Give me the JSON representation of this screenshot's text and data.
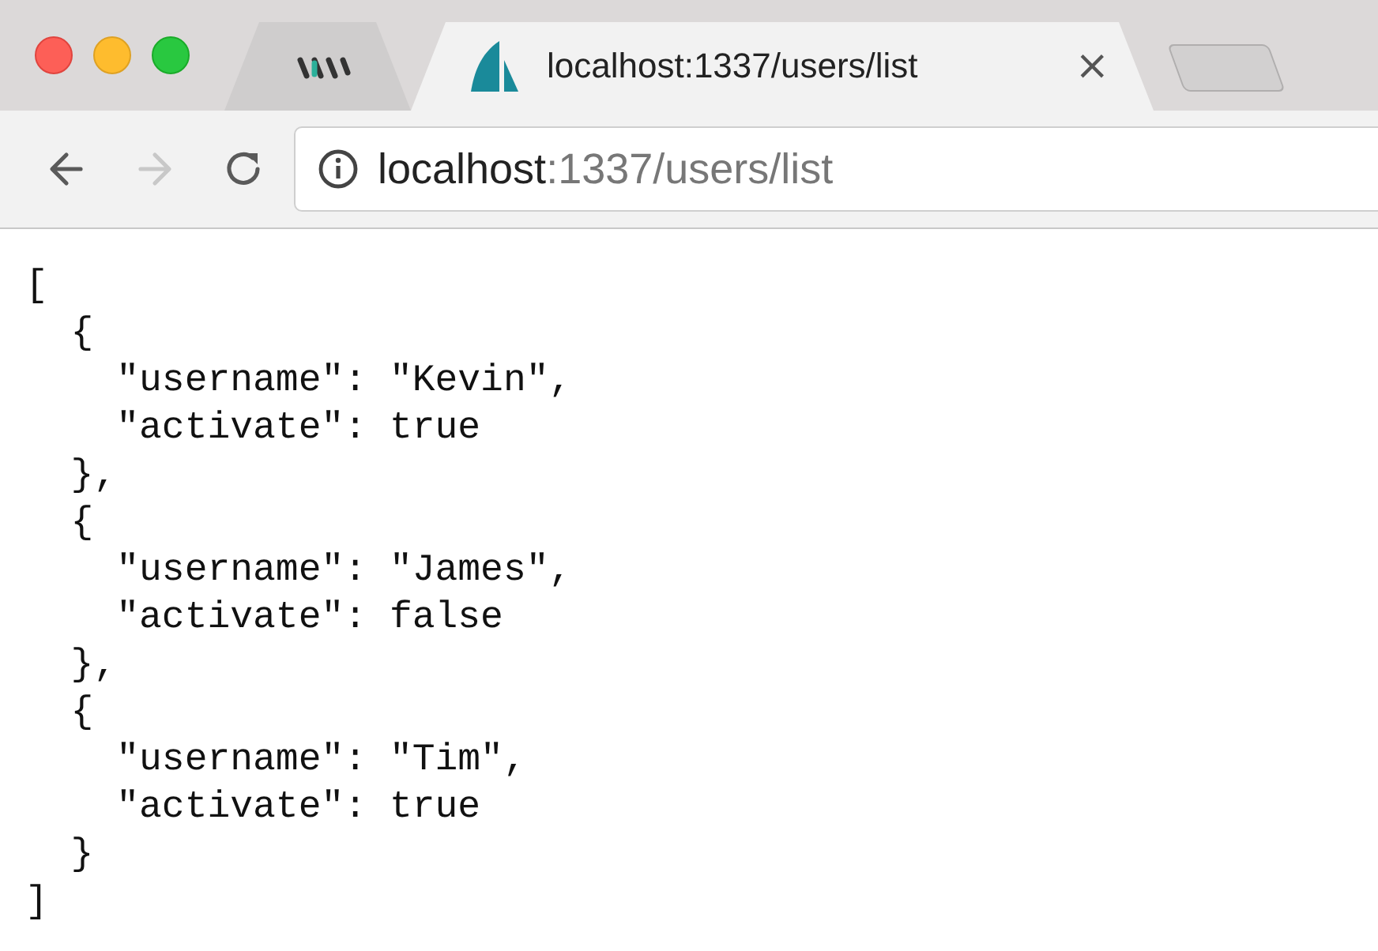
{
  "tabs": [
    {
      "kind": "icon",
      "selected": false
    },
    {
      "kind": "page",
      "title": "localhost:1337/users/list",
      "close_label": "×",
      "selected": true
    }
  ],
  "toolbar": {
    "back_disabled": false,
    "forward_disabled": true,
    "address_host": "localhost",
    "address_rest": ":1337/users/list"
  },
  "body_lines": [
    "[",
    "  {",
    "    \"username\": \"Kevin\",",
    "    \"activate\": true",
    "  },",
    "  {",
    "    \"username\": \"James\",",
    "    \"activate\": false",
    "  },",
    "  {",
    "    \"username\": \"Tim\",",
    "    \"activate\": true",
    "  }",
    "]"
  ]
}
